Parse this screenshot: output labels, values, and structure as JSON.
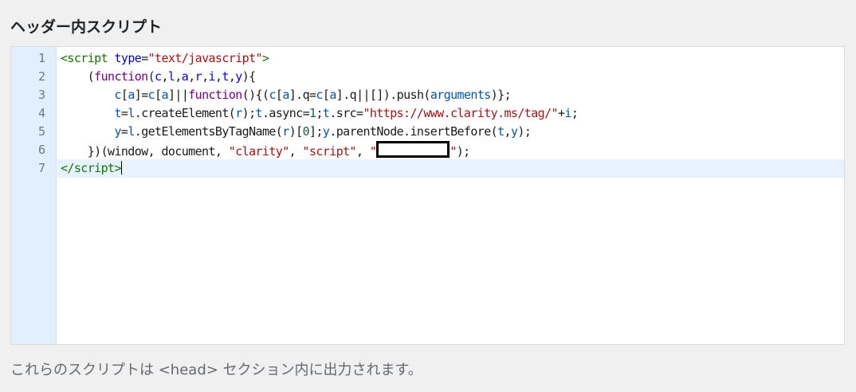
{
  "section": {
    "title": "ヘッダー内スクリプト"
  },
  "editor": {
    "line_numbers": [
      "1",
      "2",
      "3",
      "4",
      "5",
      "6",
      "7"
    ],
    "active_line": 7,
    "lines": [
      [
        {
          "t": "<script",
          "c": "tag"
        },
        {
          "t": " ",
          "c": "plain"
        },
        {
          "t": "type",
          "c": "attr"
        },
        {
          "t": "=",
          "c": "plain"
        },
        {
          "t": "\"text/javascript\"",
          "c": "str"
        },
        {
          "t": ">",
          "c": "tag"
        }
      ],
      [
        {
          "t": "    (",
          "c": "plain"
        },
        {
          "t": "function",
          "c": "kw"
        },
        {
          "t": "(",
          "c": "plain"
        },
        {
          "t": "c",
          "c": "def"
        },
        {
          "t": ",",
          "c": "plain"
        },
        {
          "t": "l",
          "c": "def"
        },
        {
          "t": ",",
          "c": "plain"
        },
        {
          "t": "a",
          "c": "def"
        },
        {
          "t": ",",
          "c": "plain"
        },
        {
          "t": "r",
          "c": "def"
        },
        {
          "t": ",",
          "c": "plain"
        },
        {
          "t": "i",
          "c": "def"
        },
        {
          "t": ",",
          "c": "plain"
        },
        {
          "t": "t",
          "c": "def"
        },
        {
          "t": ",",
          "c": "plain"
        },
        {
          "t": "y",
          "c": "def"
        },
        {
          "t": "){",
          "c": "plain"
        }
      ],
      [
        {
          "t": "        ",
          "c": "plain"
        },
        {
          "t": "c",
          "c": "var"
        },
        {
          "t": "[",
          "c": "plain"
        },
        {
          "t": "a",
          "c": "var"
        },
        {
          "t": "]=",
          "c": "plain"
        },
        {
          "t": "c",
          "c": "var"
        },
        {
          "t": "[",
          "c": "plain"
        },
        {
          "t": "a",
          "c": "var"
        },
        {
          "t": "]||",
          "c": "plain"
        },
        {
          "t": "function",
          "c": "kw"
        },
        {
          "t": "(){(",
          "c": "plain"
        },
        {
          "t": "c",
          "c": "var"
        },
        {
          "t": "[",
          "c": "plain"
        },
        {
          "t": "a",
          "c": "var"
        },
        {
          "t": "].q=",
          "c": "plain"
        },
        {
          "t": "c",
          "c": "var"
        },
        {
          "t": "[",
          "c": "plain"
        },
        {
          "t": "a",
          "c": "var"
        },
        {
          "t": "].q||[]).push(",
          "c": "plain"
        },
        {
          "t": "arguments",
          "c": "var"
        },
        {
          "t": ")};",
          "c": "plain"
        }
      ],
      [
        {
          "t": "        ",
          "c": "plain"
        },
        {
          "t": "t",
          "c": "var"
        },
        {
          "t": "=",
          "c": "plain"
        },
        {
          "t": "l",
          "c": "var"
        },
        {
          "t": ".createElement(",
          "c": "plain"
        },
        {
          "t": "r",
          "c": "var"
        },
        {
          "t": ");",
          "c": "plain"
        },
        {
          "t": "t",
          "c": "var"
        },
        {
          "t": ".async=",
          "c": "plain"
        },
        {
          "t": "1",
          "c": "num"
        },
        {
          "t": ";",
          "c": "plain"
        },
        {
          "t": "t",
          "c": "var"
        },
        {
          "t": ".src=",
          "c": "plain"
        },
        {
          "t": "\"https://www.clarity.ms/tag/\"",
          "c": "str"
        },
        {
          "t": "+",
          "c": "plain"
        },
        {
          "t": "i",
          "c": "var"
        },
        {
          "t": ";",
          "c": "plain"
        }
      ],
      [
        {
          "t": "        ",
          "c": "plain"
        },
        {
          "t": "y",
          "c": "var"
        },
        {
          "t": "=",
          "c": "plain"
        },
        {
          "t": "l",
          "c": "var"
        },
        {
          "t": ".getElementsByTagName(",
          "c": "plain"
        },
        {
          "t": "r",
          "c": "var"
        },
        {
          "t": ")[",
          "c": "plain"
        },
        {
          "t": "0",
          "c": "num"
        },
        {
          "t": "];",
          "c": "plain"
        },
        {
          "t": "y",
          "c": "var"
        },
        {
          "t": ".parentNode.insertBefore(",
          "c": "plain"
        },
        {
          "t": "t",
          "c": "var"
        },
        {
          "t": ",",
          "c": "plain"
        },
        {
          "t": "y",
          "c": "var"
        },
        {
          "t": ");",
          "c": "plain"
        }
      ],
      [
        {
          "t": "    })(window, document, ",
          "c": "plain"
        },
        {
          "t": "\"clarity\"",
          "c": "str"
        },
        {
          "t": ", ",
          "c": "plain"
        },
        {
          "t": "\"script\"",
          "c": "str"
        },
        {
          "t": ", ",
          "c": "plain"
        },
        {
          "t": "\"",
          "c": "str"
        },
        {
          "redact": true
        },
        {
          "t": "\"",
          "c": "str"
        },
        {
          "t": ");",
          "c": "plain"
        }
      ],
      [
        {
          "t": "</script",
          "c": "tag"
        },
        {
          "t": ">",
          "c": "tag"
        },
        {
          "cursor": true
        }
      ]
    ]
  },
  "description": "これらのスクリプトは <head> セクション内に出力されます。"
}
